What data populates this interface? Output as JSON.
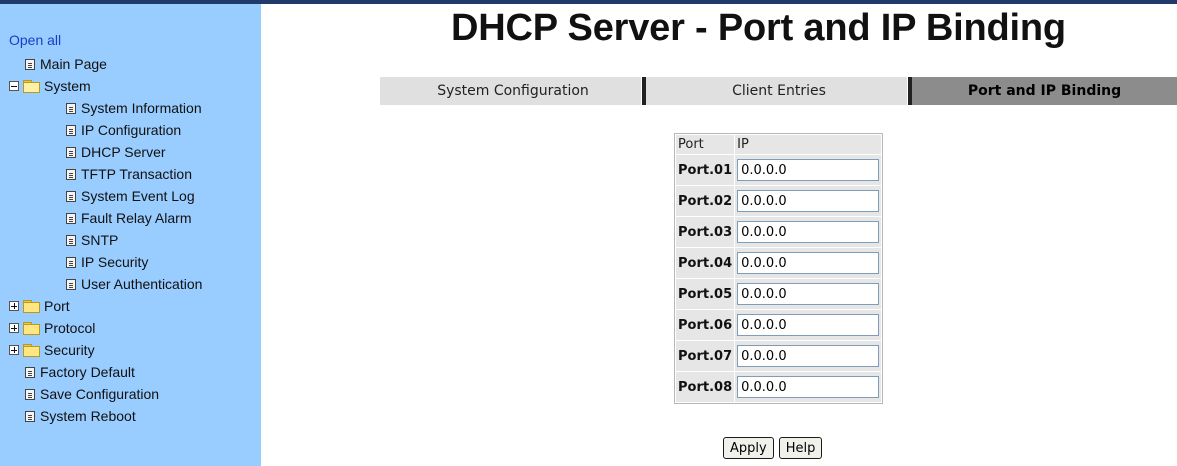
{
  "sidebar": {
    "open_all": "Open all",
    "items": [
      {
        "label": "Main Page",
        "kind": "page",
        "indent": 1
      },
      {
        "label": "System",
        "kind": "folder-open",
        "indent": 0
      },
      {
        "label": "System Information",
        "kind": "page",
        "indent": 2
      },
      {
        "label": "IP Configuration",
        "kind": "page",
        "indent": 2
      },
      {
        "label": "DHCP Server",
        "kind": "page",
        "indent": 2
      },
      {
        "label": "TFTP Transaction",
        "kind": "page",
        "indent": 2
      },
      {
        "label": "System Event Log",
        "kind": "page",
        "indent": 2
      },
      {
        "label": "Fault Relay Alarm",
        "kind": "page",
        "indent": 2
      },
      {
        "label": "SNTP",
        "kind": "page",
        "indent": 2
      },
      {
        "label": "IP Security",
        "kind": "page",
        "indent": 2
      },
      {
        "label": "User Authentication",
        "kind": "page",
        "indent": 2
      },
      {
        "label": "Port",
        "kind": "folder-closed",
        "indent": 0
      },
      {
        "label": "Protocol",
        "kind": "folder-closed",
        "indent": 0
      },
      {
        "label": "Security",
        "kind": "folder-closed",
        "indent": 0
      },
      {
        "label": "Factory Default",
        "kind": "page",
        "indent": 1
      },
      {
        "label": "Save Configuration",
        "kind": "page",
        "indent": 1
      },
      {
        "label": "System Reboot",
        "kind": "page",
        "indent": 1
      }
    ]
  },
  "page_title": "DHCP Server - Port and IP Binding",
  "tabs": [
    {
      "label": "System Configuration",
      "active": false
    },
    {
      "label": "Client Entries",
      "active": false
    },
    {
      "label": "Port and IP Binding",
      "active": true
    }
  ],
  "table": {
    "headers": {
      "port": "Port",
      "ip": "IP"
    },
    "rows": [
      {
        "port": "Port.01",
        "ip": "0.0.0.0"
      },
      {
        "port": "Port.02",
        "ip": "0.0.0.0"
      },
      {
        "port": "Port.03",
        "ip": "0.0.0.0"
      },
      {
        "port": "Port.04",
        "ip": "0.0.0.0"
      },
      {
        "port": "Port.05",
        "ip": "0.0.0.0"
      },
      {
        "port": "Port.06",
        "ip": "0.0.0.0"
      },
      {
        "port": "Port.07",
        "ip": "0.0.0.0"
      },
      {
        "port": "Port.08",
        "ip": "0.0.0.0"
      }
    ]
  },
  "buttons": {
    "apply": "Apply",
    "help": "Help"
  },
  "colors": {
    "sidebar_bg": "#99ccff",
    "active_tab": "#8c8c8c",
    "inactive_tab": "#e0e0e0",
    "link": "#1a3cc8"
  }
}
